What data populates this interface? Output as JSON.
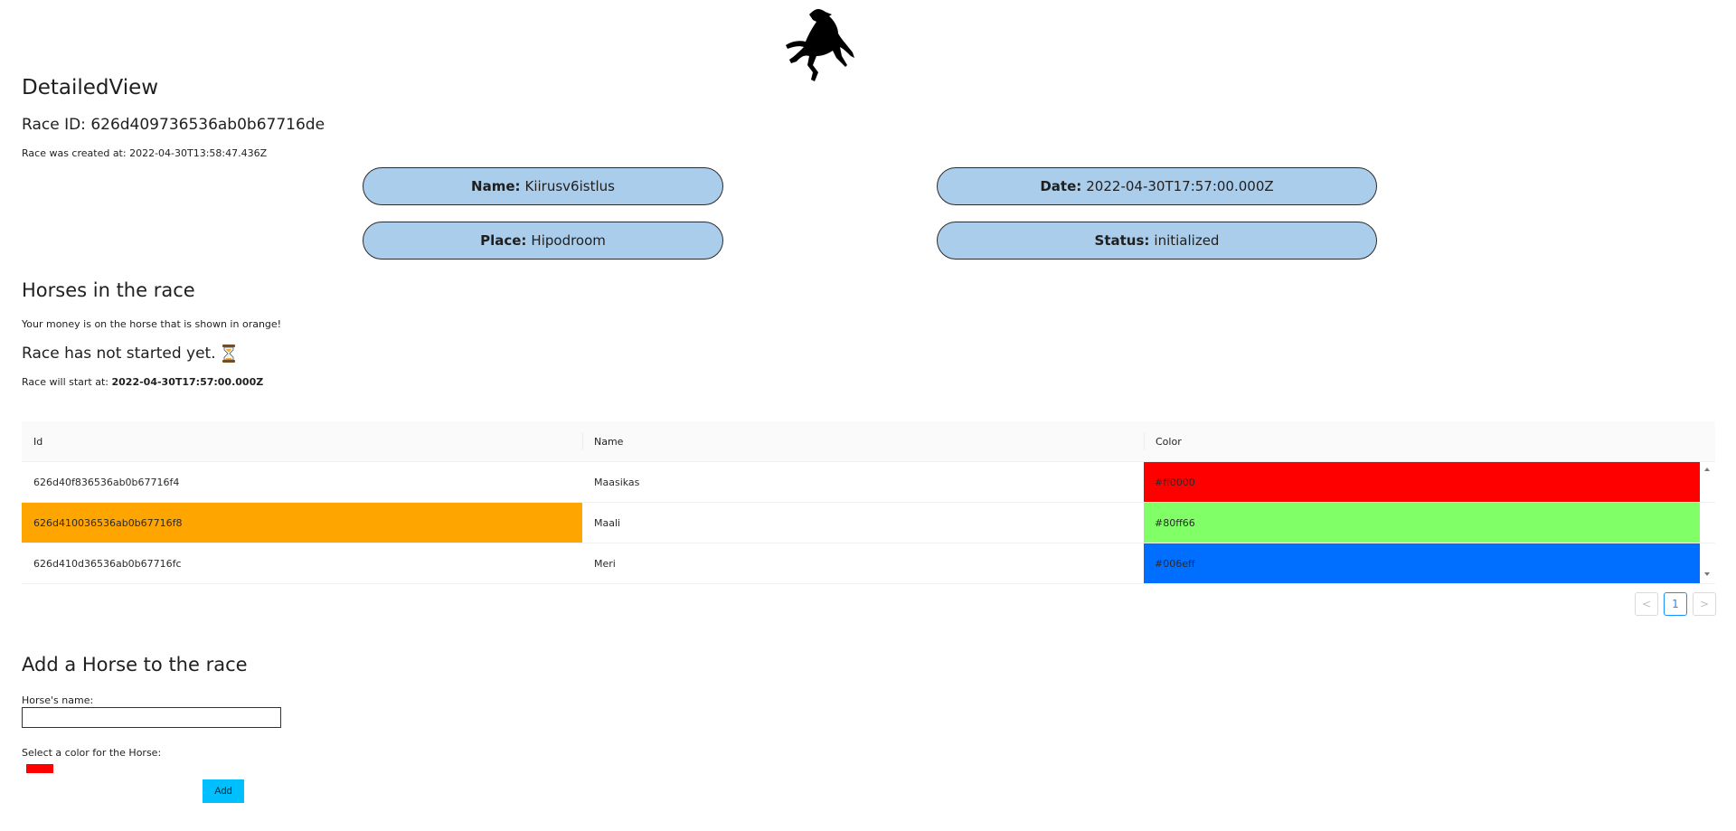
{
  "page": {
    "title": "DetailedView",
    "race_id_label": "Race ID:",
    "race_id": "626d409736536ab0b67716de",
    "created_label": "Race was created at:",
    "created_at": "2022-04-30T13:58:47.436Z"
  },
  "info": {
    "name_label": "Name:",
    "name": "Kiirusv6istlus",
    "date_label": "Date:",
    "date": "2022-04-30T17:57:00.000Z",
    "place_label": "Place:",
    "place": "Hipodroom",
    "status_label": "Status:",
    "status": "initialized"
  },
  "horses_section": {
    "title": "Horses in the race",
    "note": "Your money is on the horse that is shown in orange!",
    "status_heading": "Race has not started yet.",
    "status_icon": "hourglass-icon",
    "start_label": "Race will start at:",
    "start_time": "2022-04-30T17:57:00.000Z"
  },
  "table": {
    "columns": [
      "Id",
      "Name",
      "Color"
    ],
    "rows": [
      {
        "id": "626d40f836536ab0b67716f4",
        "name": "Maasikas",
        "color": "#ff0000",
        "selected": false
      },
      {
        "id": "626d410036536ab0b67716f8",
        "name": "Maali",
        "color": "#80ff66",
        "selected": true
      },
      {
        "id": "626d410d36536ab0b67716fc",
        "name": "Meri",
        "color": "#006eff",
        "selected": false
      }
    ],
    "highlight_color": "#ffa500"
  },
  "pagination": {
    "prev": "<",
    "current": "1",
    "next": ">"
  },
  "add_form": {
    "title": "Add a Horse to the race",
    "name_label": "Horse's name:",
    "name_value": "",
    "color_label": "Select a color for the Horse:",
    "color_value": "#ff0000",
    "submit_label": "Add"
  },
  "colors": {
    "pill_background": "#aacdec",
    "add_button": "#00bfff",
    "pager_active": "#1890ff"
  }
}
